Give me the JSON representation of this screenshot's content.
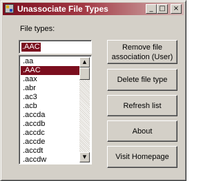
{
  "window": {
    "title": "Unassociate File Types",
    "minimize_glyph": "_",
    "maximize_glyph": "□",
    "close_glyph": "×",
    "app_icon": "app-icon"
  },
  "form": {
    "file_types_label": "File types:",
    "input_value": ".AAC",
    "list_items": [
      ".aa",
      ".AAC",
      ".aax",
      ".abr",
      ".ac3",
      ".acb",
      ".accda",
      ".accdb",
      ".accdc",
      ".accde",
      ".accdt",
      ".accdw"
    ],
    "selected_item": ".AAC",
    "scroll_up_glyph": "▲",
    "scroll_down_glyph": "▼"
  },
  "buttons": {
    "remove": "Remove file\nassociation (User)",
    "delete": "Delete file type",
    "refresh": "Refresh list",
    "about": "About",
    "homepage": "Visit Homepage"
  },
  "colors": {
    "title_bar": "#7b0e1e",
    "selection": "#7b0e1e",
    "face": "#d4d0c8"
  }
}
